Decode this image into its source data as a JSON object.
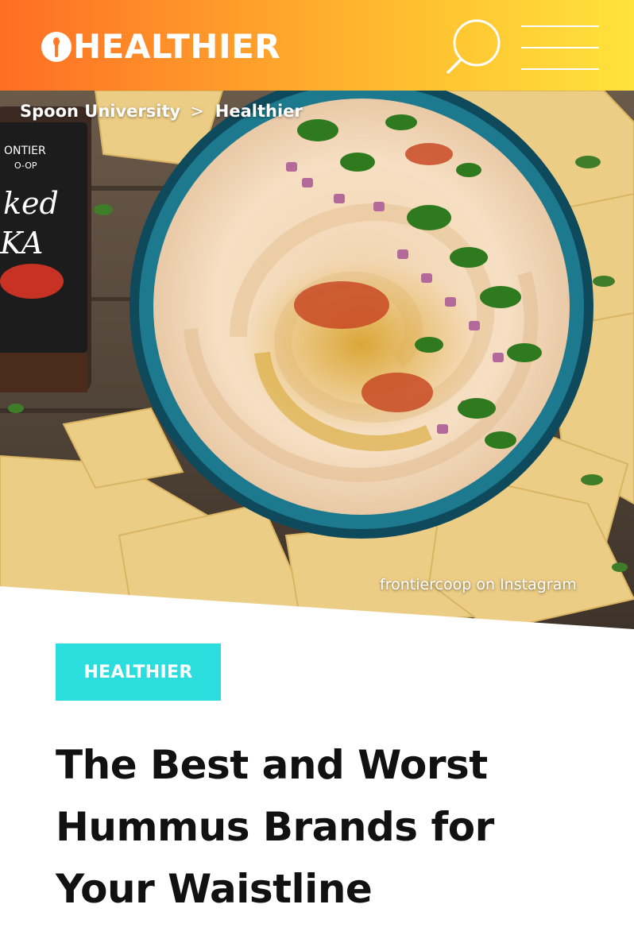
{
  "header": {
    "logo_text": "HEALTHIER",
    "logo_icon": "spoon-icon",
    "search_icon": "search-icon",
    "menu_icon": "hamburger-menu-icon",
    "gradient_colors": [
      "#ff6d24",
      "#ffe23d"
    ]
  },
  "breadcrumb": {
    "items": [
      "Spoon University",
      "Healthier"
    ],
    "separator": ">"
  },
  "hero": {
    "photo_credit": "frontiercoop on Instagram",
    "jar_label_lines": [
      "ONTIER",
      "O-OP",
      "ked",
      "KA"
    ]
  },
  "article": {
    "category": "HEALTHIER",
    "category_color": "#2bdddd",
    "title": "The Best and Worst Hummus Brands for Your Waistline"
  }
}
